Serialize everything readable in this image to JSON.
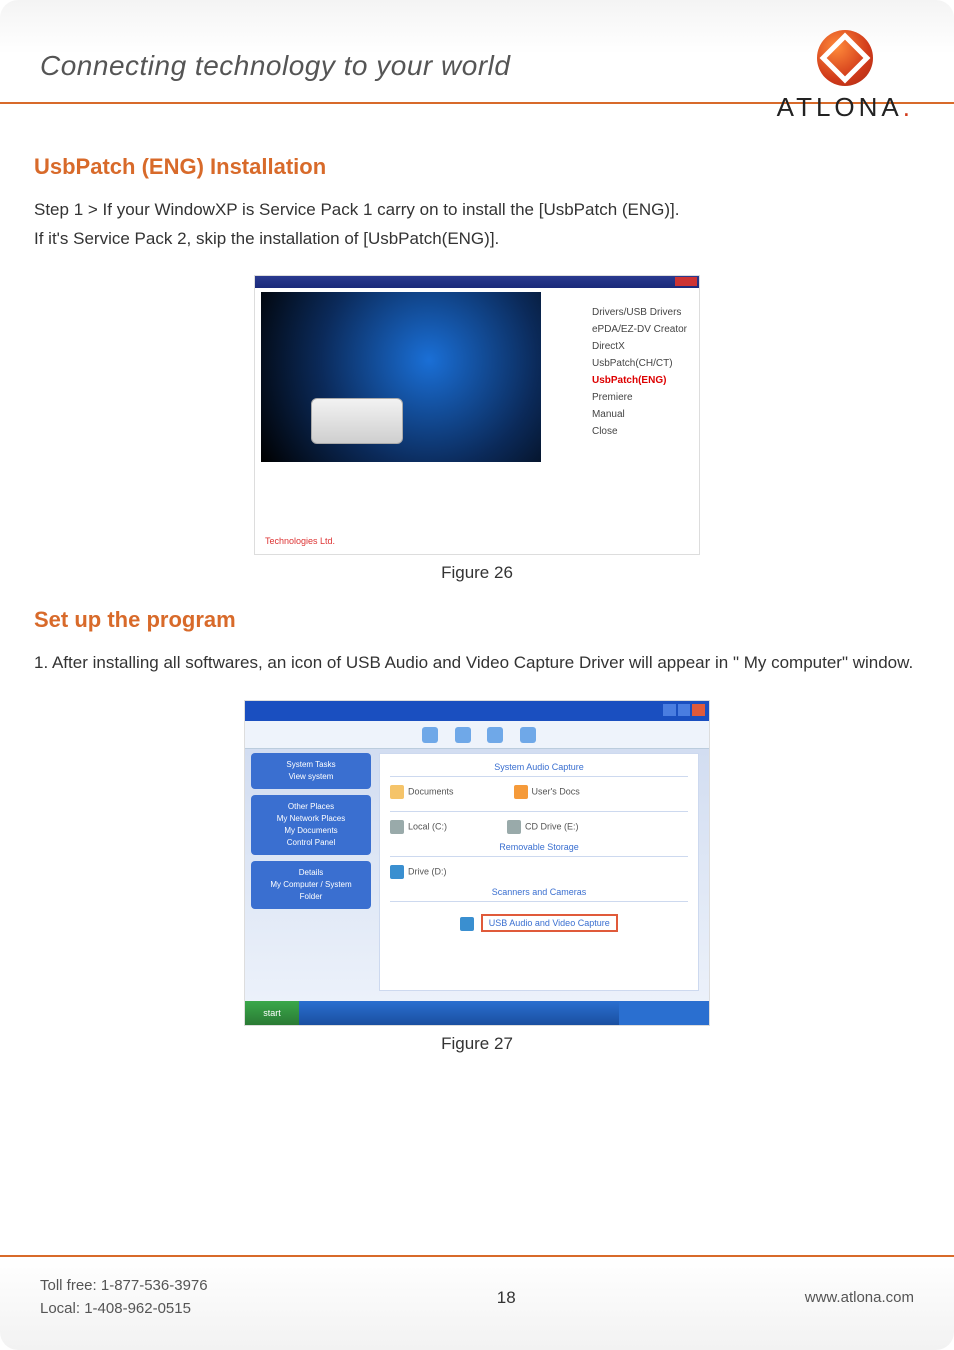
{
  "header": {
    "tagline": "Connecting technology to your world",
    "brand": "ATLONA"
  },
  "section1": {
    "title": "UsbPatch (ENG) Installation",
    "line1": "Step 1 > If your WindowXP is Service Pack 1 carry on to install the [UsbPatch (ENG)].",
    "line2": "If it's Service Pack 2, skip the installation of [UsbPatch(ENG)]."
  },
  "fig26": {
    "caption": "Figure 26",
    "menu": {
      "m1": "Drivers/USB Drivers",
      "m2": "ePDA/EZ-DV Creator",
      "m3": "DirectX",
      "m4": "UsbPatch(CH/CT)",
      "m5": "UsbPatch(ENG)",
      "m6": "Premiere",
      "m7": "Manual",
      "m8": "Close"
    },
    "foot": "Technologies Ltd."
  },
  "section2": {
    "title": "Set up the program",
    "line1": "1. After installing all softwares, an icon of USB Audio and Video Capture Driver will appear in \" My computer\" window."
  },
  "fig27": {
    "caption": "Figure 27",
    "header": "System Audio Capture",
    "side_p1_l1": "System Tasks",
    "side_p1_l2": "View system",
    "side_p2_l1": "Other Places",
    "side_p2_l2": "My Network Places",
    "side_p2_l3": "My Documents",
    "side_p2_l4": "Control Panel",
    "side_p3_l1": "Details",
    "side_p3_l2": "My Computer / System",
    "side_p3_l3": "Folder",
    "row1a": "Documents",
    "row1b": "User's Docs",
    "row2a": "Local (C:)",
    "row2b": "CD Drive (E:)",
    "row3_hdr": "Removable Storage",
    "row3a": "Drive (D:)",
    "row4_hdr": "Scanners and Cameras",
    "callout": "USB Audio and Video Capture",
    "start": "start"
  },
  "footer": {
    "tollfree_label": "Toll free: ",
    "tollfree": "1-877-536-3976",
    "local_label": "Local: ",
    "local": "1-408-962-0515",
    "page": "18",
    "url": "www.atlona.com"
  }
}
